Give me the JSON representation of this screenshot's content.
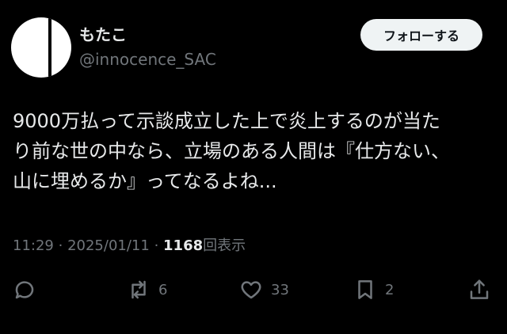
{
  "user": {
    "display_name": "もたこ",
    "handle": "@innocence_SAC",
    "follow_label": "フォローする"
  },
  "tweet": {
    "lines": [
      "9000万払って示談成立した上で炎上するのが当た",
      "り前な世の中なら、立場のある人間は『仕方ない、",
      "山に埋めるか』ってなるよね..."
    ]
  },
  "meta": {
    "time": "11:29",
    "separator": "·",
    "date": "2025/01/11",
    "views_count": "1168",
    "views_label": "回表示"
  },
  "actions": {
    "reply_icon": "reply-icon",
    "retweet_icon": "retweet-icon",
    "retweet_count": "6",
    "like_icon": "heart-icon",
    "like_count": "33",
    "bookmark_icon": "bookmark-icon",
    "bookmark_count": "2",
    "share_icon": "share-icon"
  },
  "colors": {
    "background": "#000000",
    "text": "#e7e9ea",
    "secondary": "#71767b",
    "follow_button_bg": "#eff3f4"
  }
}
